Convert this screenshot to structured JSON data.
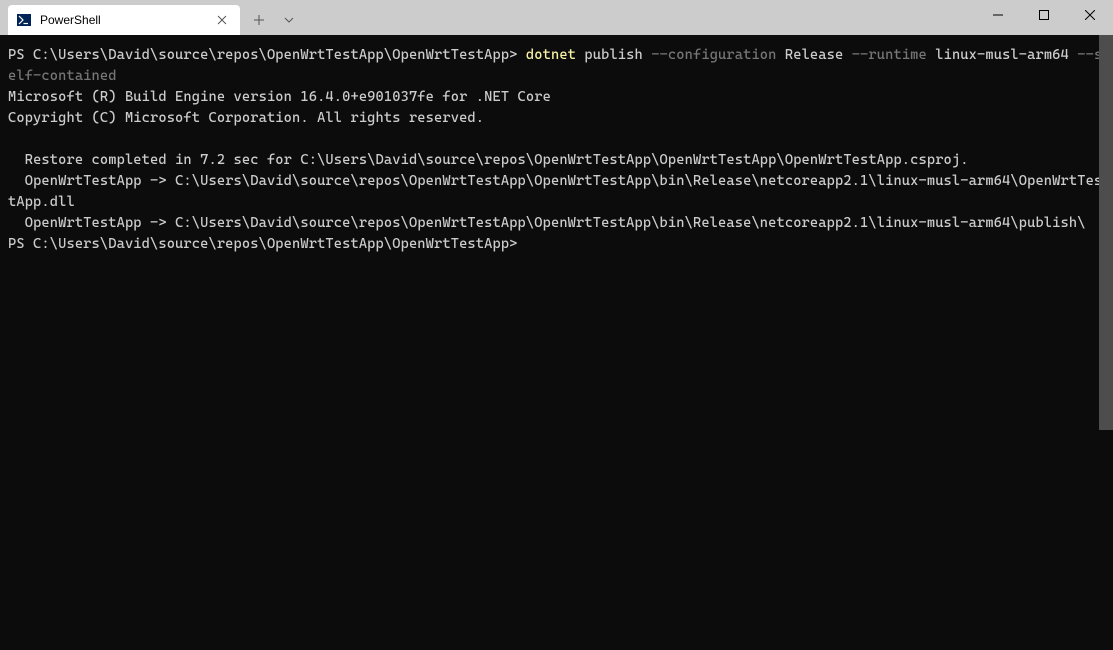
{
  "titlebar": {
    "tab_title": "PowerShell"
  },
  "terminal": {
    "prompt1_pre": "PS C:\\Users\\David\\source\\repos\\OpenWrtTestApp\\OpenWrtTestApp> ",
    "cmd_dotnet": "dotnet",
    "cmd_publish": " publish ",
    "cmd_config": "--configuration",
    "cmd_release": " Release ",
    "cmd_runtime": "--runtime",
    "cmd_rid": " linux-musl-arm64 ",
    "cmd_self": "--self-contained",
    "out_line1": "Microsoft (R) Build Engine version 16.4.0+e901037fe for .NET Core",
    "out_line2": "Copyright (C) Microsoft Corporation. All rights reserved.",
    "out_blank": "",
    "out_line3": "  Restore completed in 7.2 sec for C:\\Users\\David\\source\\repos\\OpenWrtTestApp\\OpenWrtTestApp\\OpenWrtTestApp.csproj.",
    "out_line4": "  OpenWrtTestApp -> C:\\Users\\David\\source\\repos\\OpenWrtTestApp\\OpenWrtTestApp\\bin\\Release\\netcoreapp2.1\\linux-musl-arm64\\OpenWrtTestApp.dll",
    "out_line5": "  OpenWrtTestApp -> C:\\Users\\David\\source\\repos\\OpenWrtTestApp\\OpenWrtTestApp\\bin\\Release\\netcoreapp2.1\\linux-musl-arm64\\publish\\",
    "prompt2": "PS C:\\Users\\David\\source\\repos\\OpenWrtTestApp\\OpenWrtTestApp> "
  }
}
